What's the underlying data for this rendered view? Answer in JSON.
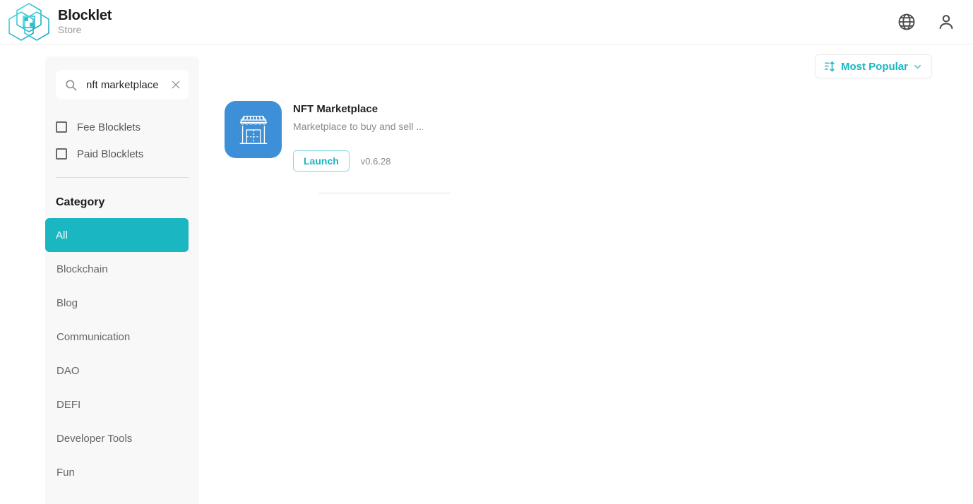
{
  "header": {
    "brand_title": "Blocklet",
    "brand_subtitle": "Store",
    "language_icon": "globe-icon",
    "account_icon": "person-icon"
  },
  "sidebar": {
    "search": {
      "value": "nft marketplace",
      "placeholder": "Search",
      "icon": "search-icon",
      "clear_icon": "close-icon"
    },
    "filters": [
      {
        "label": "Fee Blocklets",
        "checked": false
      },
      {
        "label": "Paid Blocklets",
        "checked": false
      }
    ],
    "category_title": "Category",
    "categories": [
      {
        "label": "All",
        "active": true
      },
      {
        "label": "Blockchain",
        "active": false
      },
      {
        "label": "Blog",
        "active": false
      },
      {
        "label": "Communication",
        "active": false
      },
      {
        "label": "DAO",
        "active": false
      },
      {
        "label": "DEFI",
        "active": false
      },
      {
        "label": "Developer Tools",
        "active": false
      },
      {
        "label": "Fun",
        "active": false
      }
    ]
  },
  "main": {
    "sort": {
      "label": "Most Popular",
      "sort_icon": "sort-icon",
      "chevron_icon": "chevron-down-icon"
    },
    "results": [
      {
        "title": "NFT Marketplace",
        "description": "Marketplace to buy and sell ...",
        "launch_label": "Launch",
        "version": "v0.6.28",
        "icon": "storefront-icon"
      }
    ]
  },
  "colors": {
    "accent": "#1ab6c1",
    "card_icon_bg": "#3d90d7",
    "sidebar_bg": "#f8f8f8"
  }
}
